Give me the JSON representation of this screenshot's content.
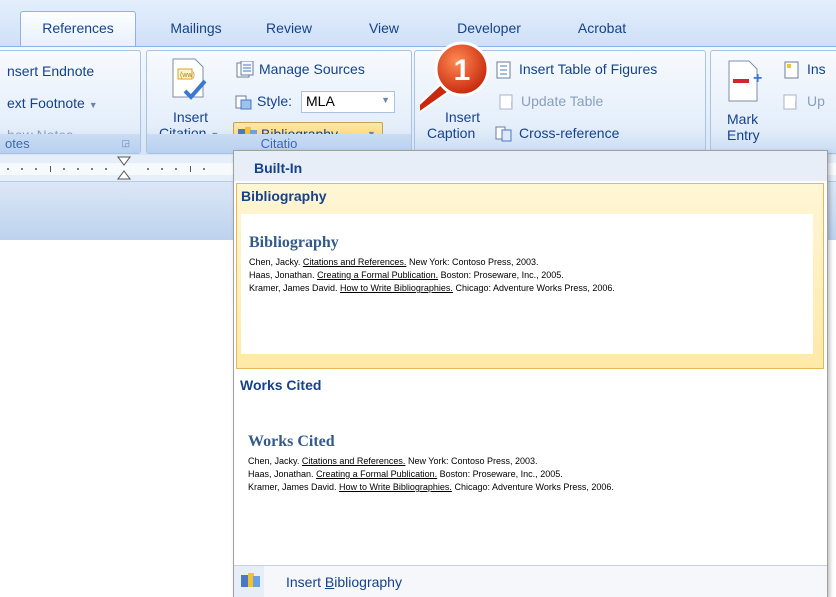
{
  "tabs": [
    "References",
    "Mailings",
    "Review",
    "View",
    "Developer",
    "Acrobat"
  ],
  "ribbon": {
    "footnotes": {
      "insert_endnote": "nsert Endnote",
      "next_footnote": "ext Footnote",
      "show_notes": "how Notes",
      "label": "otes"
    },
    "citations": {
      "insert_citation_line1": "Insert",
      "insert_citation_line2": "Citation",
      "manage_sources": "Manage Sources",
      "style_label": "Style:",
      "style_value": "MLA",
      "bibliography": "Bibliography",
      "label": "Citatio"
    },
    "captions": {
      "insert_caption_line1": "Insert",
      "insert_caption_line2": "Caption",
      "insert_table_of_figures": "Insert Table of Figures",
      "update_table": "Update Table",
      "cross_reference": "Cross-reference"
    },
    "index": {
      "mark_entry_line1": "Mark",
      "mark_entry_line2": "Entry",
      "insert_index": "Ins",
      "update_index": "Up"
    }
  },
  "callout_number": "1",
  "menu": {
    "section_header": "Built-In",
    "items": [
      {
        "name": "Bibliography",
        "preview_title": "Bibliography",
        "entries": [
          {
            "author": "Chen, Jacky.",
            "title": "Citations and References.",
            "rest": "New York: Contoso Press, 2003."
          },
          {
            "author": "Haas, Jonathan.",
            "title": "Creating a Formal Publication.",
            "rest": "Boston: Proseware, Inc., 2005."
          },
          {
            "author": "Kramer, James David.",
            "title": "How to Write Bibliographies.",
            "rest": "Chicago: Adventure Works Press, 2006."
          }
        ]
      },
      {
        "name": "Works Cited",
        "preview_title": "Works Cited",
        "entries": [
          {
            "author": "Chen, Jacky.",
            "title": "Citations and References.",
            "rest": "New York: Contoso Press, 2003."
          },
          {
            "author": "Haas, Jonathan.",
            "title": "Creating a Formal Publication.",
            "rest": "Boston: Proseware, Inc., 2005."
          },
          {
            "author": "Kramer, James David.",
            "title": "How to Write Bibliographies.",
            "rest": "Chicago: Adventure Works Press, 2006."
          }
        ]
      }
    ],
    "insert_bibliography_pre": "Insert ",
    "insert_bibliography_accel": "B",
    "insert_bibliography_post": "ibliography"
  },
  "colors": {
    "accent": "#15428b",
    "highlight": "#ffe9a8",
    "callout": "#e8401c"
  },
  "icons": [
    "insert-citation-icon",
    "manage-sources-icon",
    "style-icon",
    "bibliography-icon",
    "insert-caption-icon",
    "table-of-figures-icon",
    "update-table-icon",
    "cross-reference-icon",
    "mark-entry-icon",
    "insert-index-icon",
    "update-index-icon",
    "dialog-launcher-icon",
    "dropdown-arrow-icon"
  ]
}
